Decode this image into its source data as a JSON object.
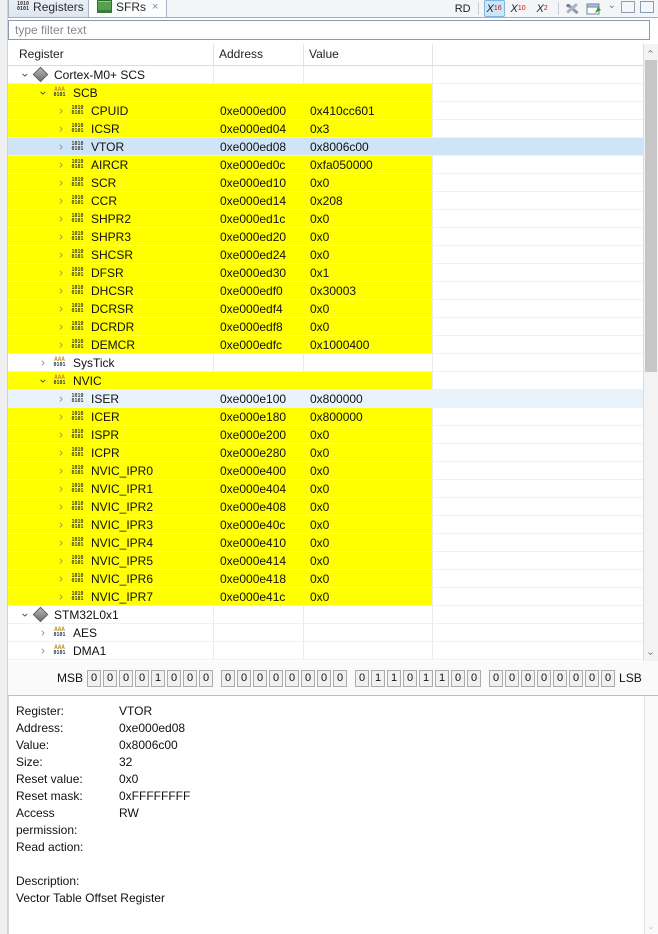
{
  "tabs": {
    "registers": {
      "label": "Registers"
    },
    "sfrs": {
      "label": "SFRs",
      "close_glyph": "×"
    }
  },
  "toolbar": {
    "rd_label": "RD",
    "radix_buttons": [
      {
        "label": "X",
        "sub": "16",
        "active": true
      },
      {
        "label": "X",
        "sub": "10",
        "active": false
      },
      {
        "label": "X",
        "sub": "2",
        "active": false
      }
    ],
    "icons": [
      "tools-icon",
      "export-icon",
      "view-menu-icon",
      "minimize-icon",
      "maximize-icon"
    ]
  },
  "filter": {
    "placeholder": "type filter text"
  },
  "table": {
    "columns": [
      "Register",
      "Address",
      "Value"
    ],
    "rows": [
      {
        "name": "Cortex-M0+ SCS",
        "level": 1,
        "expanded": true,
        "icon": "chip",
        "address": "",
        "value": "",
        "highlight": "none"
      },
      {
        "name": "SCB",
        "level": 2,
        "expanded": true,
        "icon": "group",
        "address": "",
        "value": "",
        "highlight": "yellow"
      },
      {
        "name": "CPUID",
        "level": 3,
        "expanded": false,
        "icon": "register",
        "address": "0xe000ed00",
        "value": "0x410cc601",
        "highlight": "yellow"
      },
      {
        "name": "ICSR",
        "level": 3,
        "expanded": false,
        "icon": "register",
        "address": "0xe000ed04",
        "value": "0x3",
        "highlight": "yellow"
      },
      {
        "name": "VTOR",
        "level": 3,
        "expanded": false,
        "icon": "register",
        "address": "0xe000ed08",
        "value": "0x8006c00",
        "highlight": "selected"
      },
      {
        "name": "AIRCR",
        "level": 3,
        "expanded": false,
        "icon": "register",
        "address": "0xe000ed0c",
        "value": "0xfa050000",
        "highlight": "yellow"
      },
      {
        "name": "SCR",
        "level": 3,
        "expanded": false,
        "icon": "register",
        "address": "0xe000ed10",
        "value": "0x0",
        "highlight": "yellow"
      },
      {
        "name": "CCR",
        "level": 3,
        "expanded": false,
        "icon": "register",
        "address": "0xe000ed14",
        "value": "0x208",
        "highlight": "yellow"
      },
      {
        "name": "SHPR2",
        "level": 3,
        "expanded": false,
        "icon": "register",
        "address": "0xe000ed1c",
        "value": "0x0",
        "highlight": "yellow"
      },
      {
        "name": "SHPR3",
        "level": 3,
        "expanded": false,
        "icon": "register",
        "address": "0xe000ed20",
        "value": "0x0",
        "highlight": "yellow"
      },
      {
        "name": "SHCSR",
        "level": 3,
        "expanded": false,
        "icon": "register",
        "address": "0xe000ed24",
        "value": "0x0",
        "highlight": "yellow"
      },
      {
        "name": "DFSR",
        "level": 3,
        "expanded": false,
        "icon": "register",
        "address": "0xe000ed30",
        "value": "0x1",
        "highlight": "yellow"
      },
      {
        "name": "DHCSR",
        "level": 3,
        "expanded": false,
        "icon": "register",
        "address": "0xe000edf0",
        "value": "0x30003",
        "highlight": "yellow"
      },
      {
        "name": "DCRSR",
        "level": 3,
        "expanded": false,
        "icon": "register",
        "address": "0xe000edf4",
        "value": "0x0",
        "highlight": "yellow"
      },
      {
        "name": "DCRDR",
        "level": 3,
        "expanded": false,
        "icon": "register",
        "address": "0xe000edf8",
        "value": "0x0",
        "highlight": "yellow"
      },
      {
        "name": "DEMCR",
        "level": 3,
        "expanded": false,
        "icon": "register",
        "address": "0xe000edfc",
        "value": "0x1000400",
        "highlight": "yellow"
      },
      {
        "name": "SysTick",
        "level": 2,
        "expanded": false,
        "icon": "group",
        "address": "",
        "value": "",
        "highlight": "none"
      },
      {
        "name": "NVIC",
        "level": 2,
        "expanded": true,
        "icon": "group",
        "address": "",
        "value": "",
        "highlight": "yellow"
      },
      {
        "name": "ISER",
        "level": 3,
        "expanded": false,
        "icon": "register",
        "address": "0xe000e100",
        "value": "0x800000",
        "highlight": "lightblue"
      },
      {
        "name": "ICER",
        "level": 3,
        "expanded": false,
        "icon": "register",
        "address": "0xe000e180",
        "value": "0x800000",
        "highlight": "yellow"
      },
      {
        "name": "ISPR",
        "level": 3,
        "expanded": false,
        "icon": "register",
        "address": "0xe000e200",
        "value": "0x0",
        "highlight": "yellow"
      },
      {
        "name": "ICPR",
        "level": 3,
        "expanded": false,
        "icon": "register",
        "address": "0xe000e280",
        "value": "0x0",
        "highlight": "yellow"
      },
      {
        "name": "NVIC_IPR0",
        "level": 3,
        "expanded": false,
        "icon": "register",
        "address": "0xe000e400",
        "value": "0x0",
        "highlight": "yellow"
      },
      {
        "name": "NVIC_IPR1",
        "level": 3,
        "expanded": false,
        "icon": "register",
        "address": "0xe000e404",
        "value": "0x0",
        "highlight": "yellow"
      },
      {
        "name": "NVIC_IPR2",
        "level": 3,
        "expanded": false,
        "icon": "register",
        "address": "0xe000e408",
        "value": "0x0",
        "highlight": "yellow"
      },
      {
        "name": "NVIC_IPR3",
        "level": 3,
        "expanded": false,
        "icon": "register",
        "address": "0xe000e40c",
        "value": "0x0",
        "highlight": "yellow"
      },
      {
        "name": "NVIC_IPR4",
        "level": 3,
        "expanded": false,
        "icon": "register",
        "address": "0xe000e410",
        "value": "0x0",
        "highlight": "yellow"
      },
      {
        "name": "NVIC_IPR5",
        "level": 3,
        "expanded": false,
        "icon": "register",
        "address": "0xe000e414",
        "value": "0x0",
        "highlight": "yellow"
      },
      {
        "name": "NVIC_IPR6",
        "level": 3,
        "expanded": false,
        "icon": "register",
        "address": "0xe000e418",
        "value": "0x0",
        "highlight": "yellow"
      },
      {
        "name": "NVIC_IPR7",
        "level": 3,
        "expanded": false,
        "icon": "register",
        "address": "0xe000e41c",
        "value": "0x0",
        "highlight": "yellow"
      },
      {
        "name": "STM32L0x1",
        "level": 1,
        "expanded": true,
        "icon": "chip",
        "address": "",
        "value": "",
        "highlight": "none"
      },
      {
        "name": "AES",
        "level": 2,
        "expanded": false,
        "icon": "group",
        "address": "",
        "value": "",
        "highlight": "none"
      },
      {
        "name": "DMA1",
        "level": 2,
        "expanded": false,
        "icon": "group",
        "address": "",
        "value": "",
        "highlight": "none"
      }
    ]
  },
  "bits": {
    "msb_label": "MSB",
    "lsb_label": "LSB",
    "groups": [
      [
        "0",
        "0",
        "0",
        "0",
        "1",
        "0",
        "0",
        "0"
      ],
      [
        "0",
        "0",
        "0",
        "0",
        "0",
        "0",
        "0",
        "0"
      ],
      [
        "0",
        "1",
        "1",
        "0",
        "1",
        "1",
        "0",
        "0"
      ],
      [
        "0",
        "0",
        "0",
        "0",
        "0",
        "0",
        "0",
        "0"
      ]
    ]
  },
  "details": {
    "fields": [
      {
        "label": "Register:",
        "value": "VTOR"
      },
      {
        "label": "Address:",
        "value": "0xe000ed08"
      },
      {
        "label": "Value:",
        "value": "0x8006c00"
      },
      {
        "label": "Size:",
        "value": "32"
      },
      {
        "label": "Reset value:",
        "value": "0x0"
      },
      {
        "label": "Reset mask:",
        "value": "0xFFFFFFFF"
      },
      {
        "label": "Access permission:",
        "value": "RW"
      },
      {
        "label": "Read action:",
        "value": ""
      }
    ],
    "description_label": "Description:",
    "description": "Vector Table Offset Register"
  },
  "colors": {
    "changed_row": "#ffff00",
    "selected_row": "#cfe4f7",
    "highlight_row": "#e9f3fc",
    "active_toggle_bg": "#cde6f7",
    "radix_subscript": "#cc1111",
    "sfr_chip_green": "#57a050"
  }
}
